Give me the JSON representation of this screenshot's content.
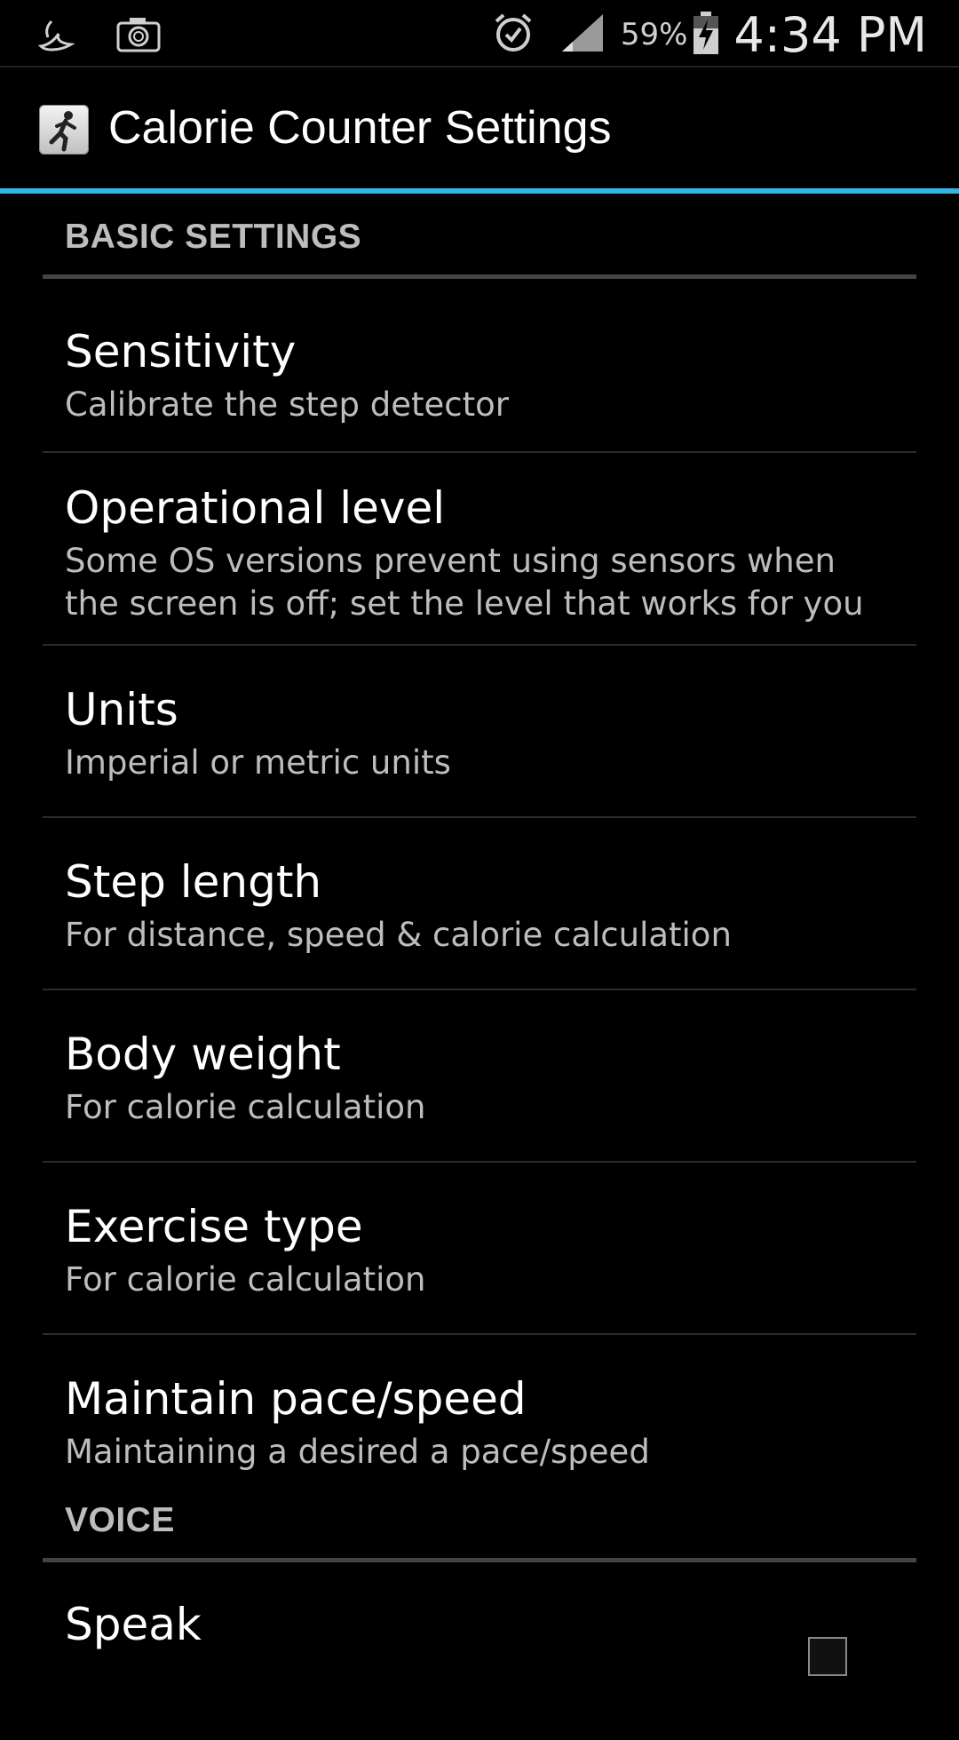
{
  "status_bar": {
    "icons_left": [
      "moon-bird-icon",
      "camera-icon"
    ],
    "icons_right": [
      "alarm-icon",
      "signal-icon",
      "battery-charging-icon"
    ],
    "battery": "59%",
    "time": "4:34 PM"
  },
  "action_bar": {
    "title": "Calorie Counter Settings",
    "accent_color": "#33b5e5"
  },
  "sections": [
    {
      "header": "BASIC SETTINGS",
      "items": [
        {
          "title": "Sensitivity",
          "summary": "Calibrate the step detector"
        },
        {
          "title": "Operational level",
          "summary_lines": [
            "Some OS versions prevent using sensors when",
            "the screen is off; set the level that works for you"
          ]
        },
        {
          "title": "Units",
          "summary": "Imperial or metric units"
        },
        {
          "title": "Step length",
          "summary": "For distance, speed & calorie calculation"
        },
        {
          "title": "Body weight",
          "summary": "For calorie calculation"
        },
        {
          "title": "Exercise type",
          "summary": "For calorie calculation"
        },
        {
          "title": "Maintain pace/speed",
          "summary": "Maintaining a desired a pace/speed"
        }
      ]
    },
    {
      "header": "VOICE",
      "items": [
        {
          "title": "Speak",
          "checked": false
        }
      ]
    }
  ]
}
